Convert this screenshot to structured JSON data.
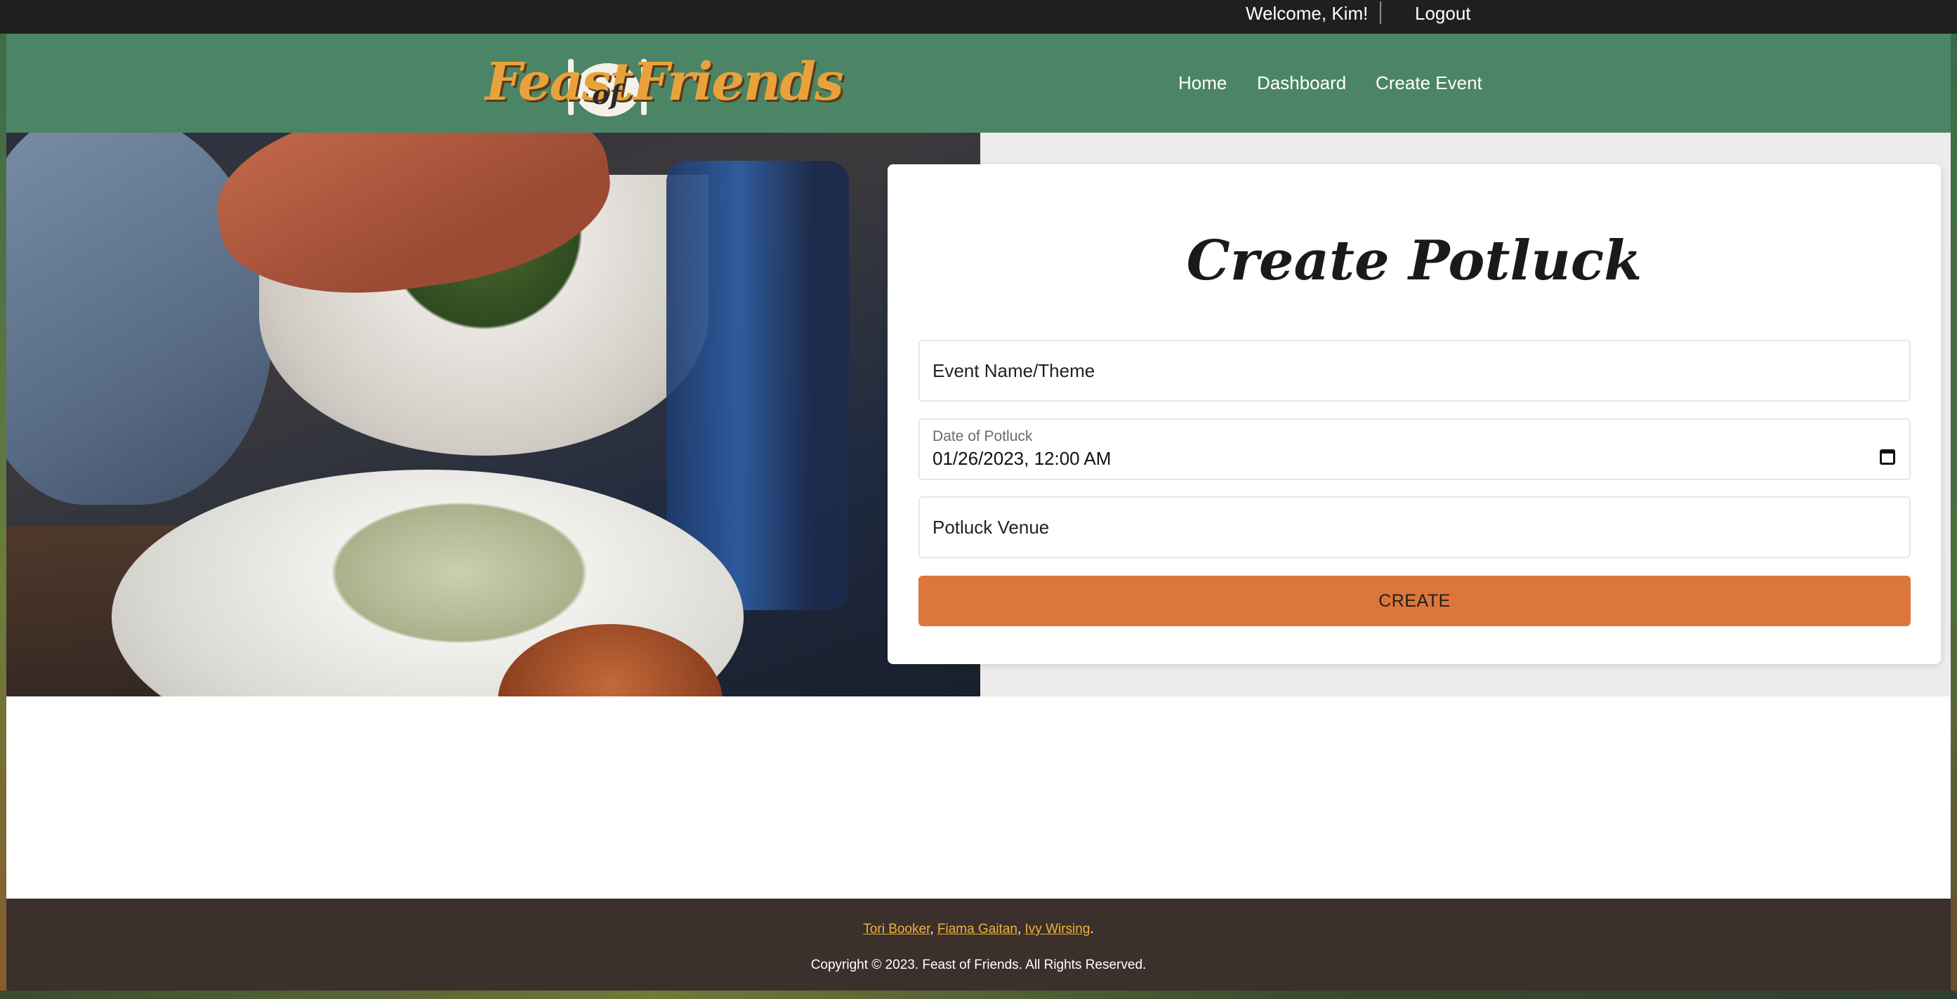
{
  "topbar": {
    "welcome": "Welcome, Kim!",
    "logout": "Logout"
  },
  "header": {
    "logo": {
      "word1": "Feast",
      "word2": "of",
      "word3": "Friends"
    },
    "nav": [
      "Home",
      "Dashboard",
      "Create Event"
    ]
  },
  "form": {
    "title": "Create Potluck",
    "event_name_placeholder": "Event Name/Theme",
    "date_label": "Date of Potluck",
    "date_value": "01/26/2023, 12:00 AM",
    "venue_placeholder": "Potluck Venue",
    "create_label": "CREATE"
  },
  "footer": {
    "authors": [
      "Tori Booker",
      "Fiama Gaitan",
      "Ivy Wirsing"
    ],
    "sep1": ", ",
    "sep2": ", ",
    "end": ".",
    "copyright": "Copyright © 2023. Feast of Friends. All Rights Reserved."
  },
  "colors": {
    "topbar": "#1f1f1f",
    "header": "#4b8566",
    "accent": "#dc763a",
    "footer": "#3b302b",
    "link": "#f0b23a"
  }
}
